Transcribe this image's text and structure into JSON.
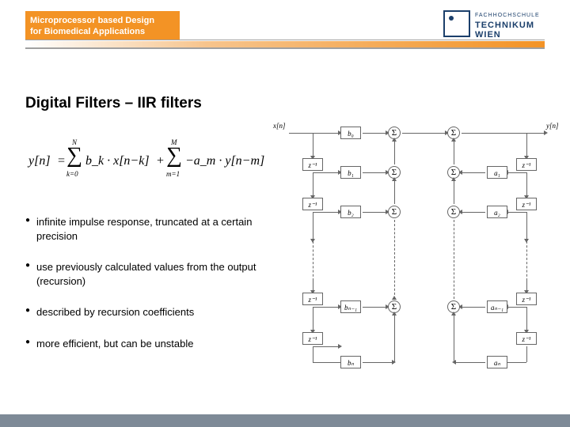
{
  "header": {
    "course_line1": "Microprocessor based Design",
    "course_line2": "for Biomedical Applications",
    "logo_line1": "FACHHOCHSCHULE",
    "logo_line2": "TECHNIKUM WIEN"
  },
  "title": "Digital Filters – IIR filters",
  "formula": {
    "lhs": "y[n]",
    "eq": "=",
    "sum1_top": "N",
    "sum1_bot": "k=0",
    "term1": "b_k · x[n−k]",
    "plus": "+",
    "sum2_top": "M",
    "sum2_bot": "m=1",
    "term2": "−a_m · y[n−m]"
  },
  "bullets": [
    "infinite impulse response, truncated at a certain precision",
    "use previously calculated values from the output (recursion)",
    "described by recursion coefficients",
    "more efficient, but can be unstable"
  ],
  "diagram": {
    "input": "x[n]",
    "output": "y[n]",
    "z": "z⁻¹",
    "sum": "Σ",
    "b": [
      "b₀",
      "b₁",
      "b₂",
      "bₙ₋₁",
      "bₙ"
    ],
    "a": [
      "a₁",
      "a₂",
      "aₙ₋₁",
      "aₙ"
    ]
  }
}
